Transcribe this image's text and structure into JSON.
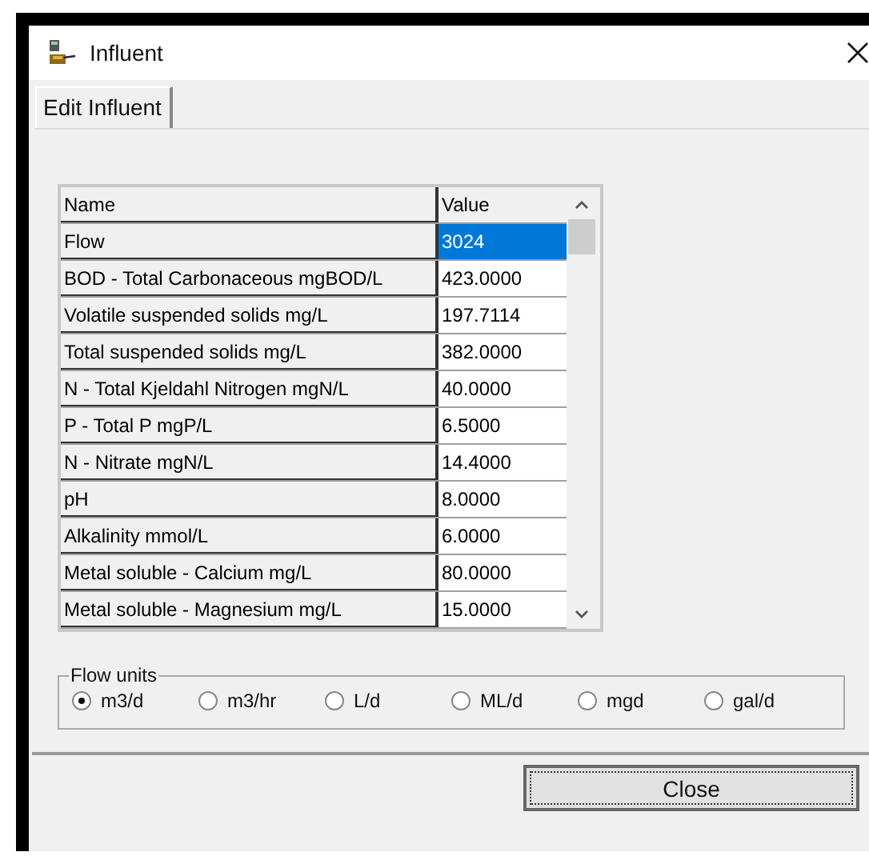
{
  "window": {
    "title": "Influent"
  },
  "tabs": [
    {
      "label": "Edit Influent",
      "selected": true
    }
  ],
  "table": {
    "columns": [
      "Name",
      "Value"
    ],
    "rows": [
      {
        "name": "Flow",
        "value": "3024",
        "selected": true
      },
      {
        "name": "BOD - Total Carbonaceous mgBOD/L",
        "value": "423.0000",
        "selected": false
      },
      {
        "name": "Volatile suspended solids mg/L",
        "value": "197.7114",
        "selected": false
      },
      {
        "name": "Total suspended solids mg/L",
        "value": "382.0000",
        "selected": false
      },
      {
        "name": "N - Total Kjeldahl Nitrogen mgN/L",
        "value": "40.0000",
        "selected": false
      },
      {
        "name": "P - Total P mgP/L",
        "value": "6.5000",
        "selected": false
      },
      {
        "name": "N - Nitrate mgN/L",
        "value": "14.4000",
        "selected": false
      },
      {
        "name": "pH",
        "value": "8.0000",
        "selected": false
      },
      {
        "name": "Alkalinity mmol/L",
        "value": "6.0000",
        "selected": false
      },
      {
        "name": "Metal soluble - Calcium mg/L",
        "value": "80.0000",
        "selected": false
      },
      {
        "name": "Metal soluble - Magnesium mg/L",
        "value": "15.0000",
        "selected": false
      }
    ]
  },
  "flow_units": {
    "label": "Flow units",
    "options": [
      {
        "label": "m3/d",
        "selected": true
      },
      {
        "label": "m3/hr",
        "selected": false
      },
      {
        "label": "L/d",
        "selected": false
      },
      {
        "label": "ML/d",
        "selected": false
      },
      {
        "label": "mgd",
        "selected": false
      },
      {
        "label": "gal/d",
        "selected": false
      }
    ]
  },
  "buttons": [
    {
      "label": "Close"
    }
  ]
}
